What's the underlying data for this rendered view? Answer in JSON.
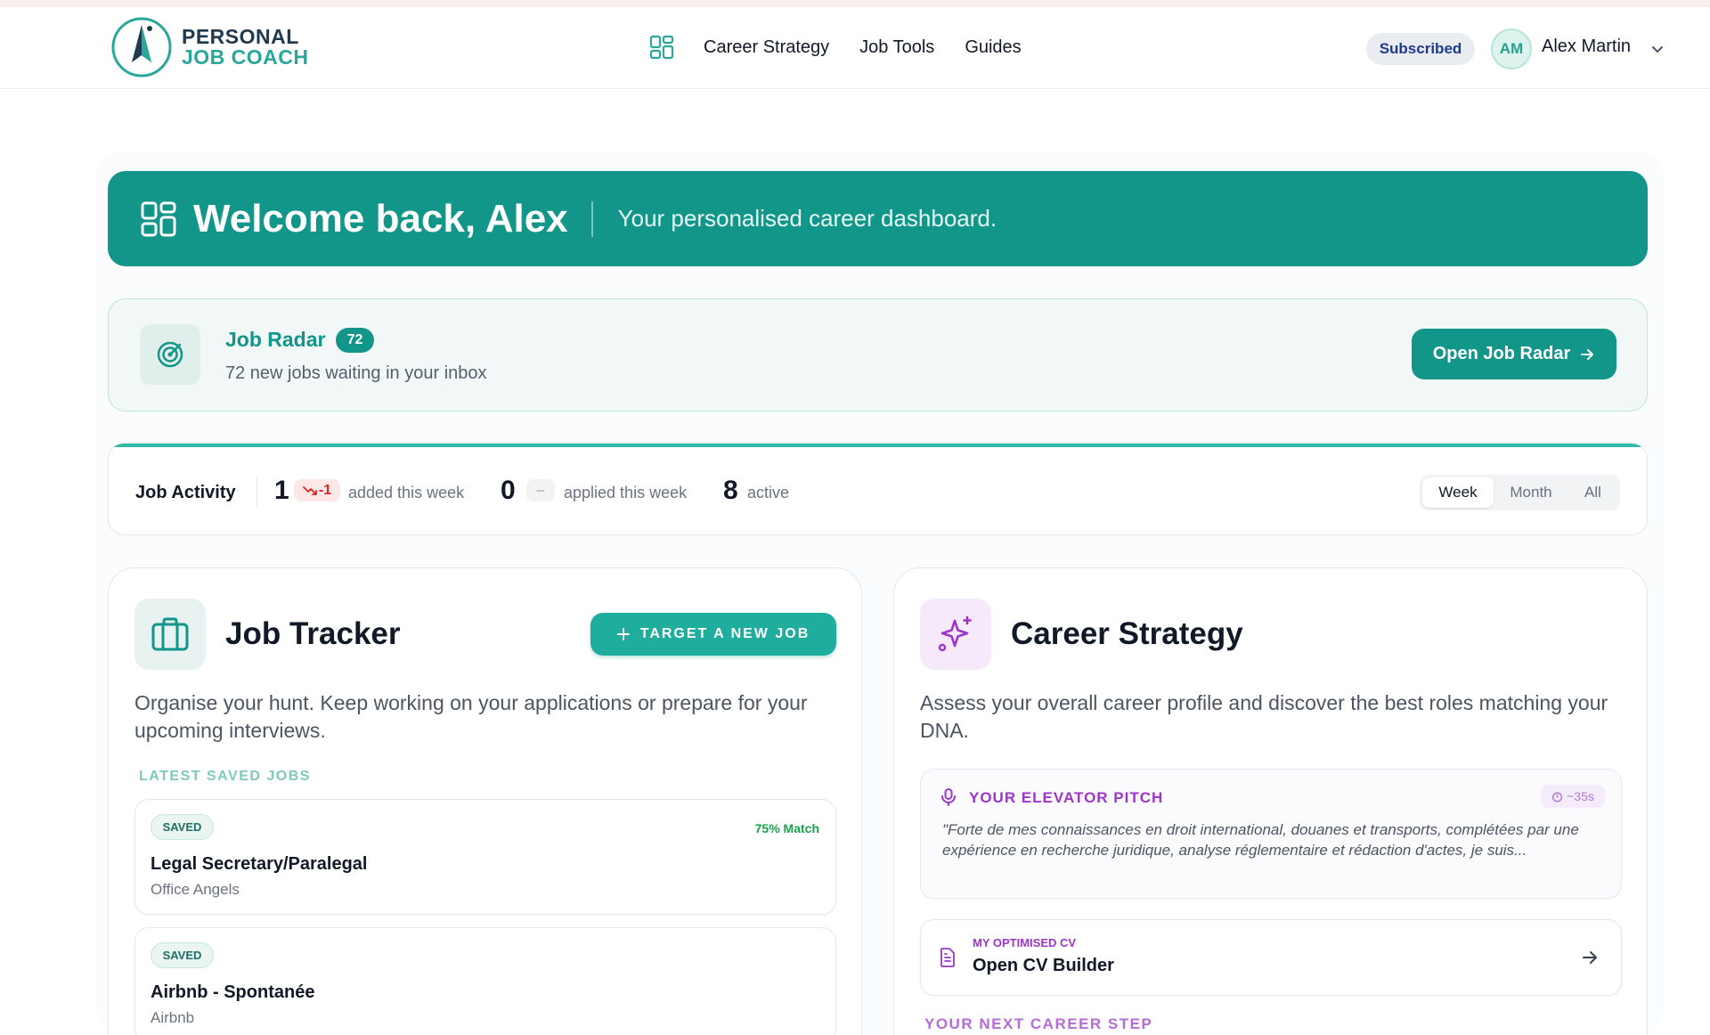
{
  "brand": {
    "line1": "PERSONAL",
    "line2": "JOB COACH"
  },
  "nav": {
    "items": [
      "Career Strategy",
      "Job Tools",
      "Guides"
    ]
  },
  "user": {
    "status": "Subscribed",
    "initials": "AM",
    "name": "Alex Martin"
  },
  "welcome": {
    "title": "Welcome back, Alex",
    "subtitle": "Your personalised career dashboard."
  },
  "job_radar": {
    "title": "Job Radar",
    "count": "72",
    "description": "72 new jobs waiting in your inbox",
    "button": "Open Job Radar"
  },
  "activity": {
    "label": "Job Activity",
    "added": {
      "value": "1",
      "trend": "-1",
      "text": "added this week"
    },
    "applied": {
      "value": "0",
      "trend": "–",
      "text": "applied this week"
    },
    "active": {
      "value": "8",
      "text": "active"
    },
    "periods": [
      "Week",
      "Month",
      "All"
    ],
    "selected_period": "Week"
  },
  "job_tracker": {
    "title": "Job Tracker",
    "button": "TARGET A NEW JOB",
    "description": "Organise your hunt. Keep working on your applications or prepare for your upcoming interviews.",
    "section_label": "LATEST SAVED JOBS",
    "jobs": [
      {
        "status": "SAVED",
        "match": "75% Match",
        "title": "Legal Secretary/Paralegal",
        "company": "Office Angels"
      },
      {
        "status": "SAVED",
        "match": "",
        "title": "Airbnb - Spontanée",
        "company": "Airbnb"
      }
    ]
  },
  "career_strategy": {
    "title": "Career Strategy",
    "description": "Assess your overall career profile and discover the best roles matching your DNA.",
    "pitch": {
      "title": "YOUR ELEVATOR PITCH",
      "duration": "~35s",
      "quote": "\"Forte de mes connaissances en droit international, douanes et transports, complétées par une expérience en recherche juridique, analyse réglementaire et rédaction d'actes, je suis..."
    },
    "cv": {
      "label": "MY OPTIMISED CV",
      "title": "Open CV Builder"
    },
    "next_step_label": "YOUR NEXT CAREER STEP"
  },
  "colors": {
    "teal": "#12968a",
    "purple": "#9b36c9",
    "danger": "#dc2626",
    "success": "#16a34a"
  }
}
